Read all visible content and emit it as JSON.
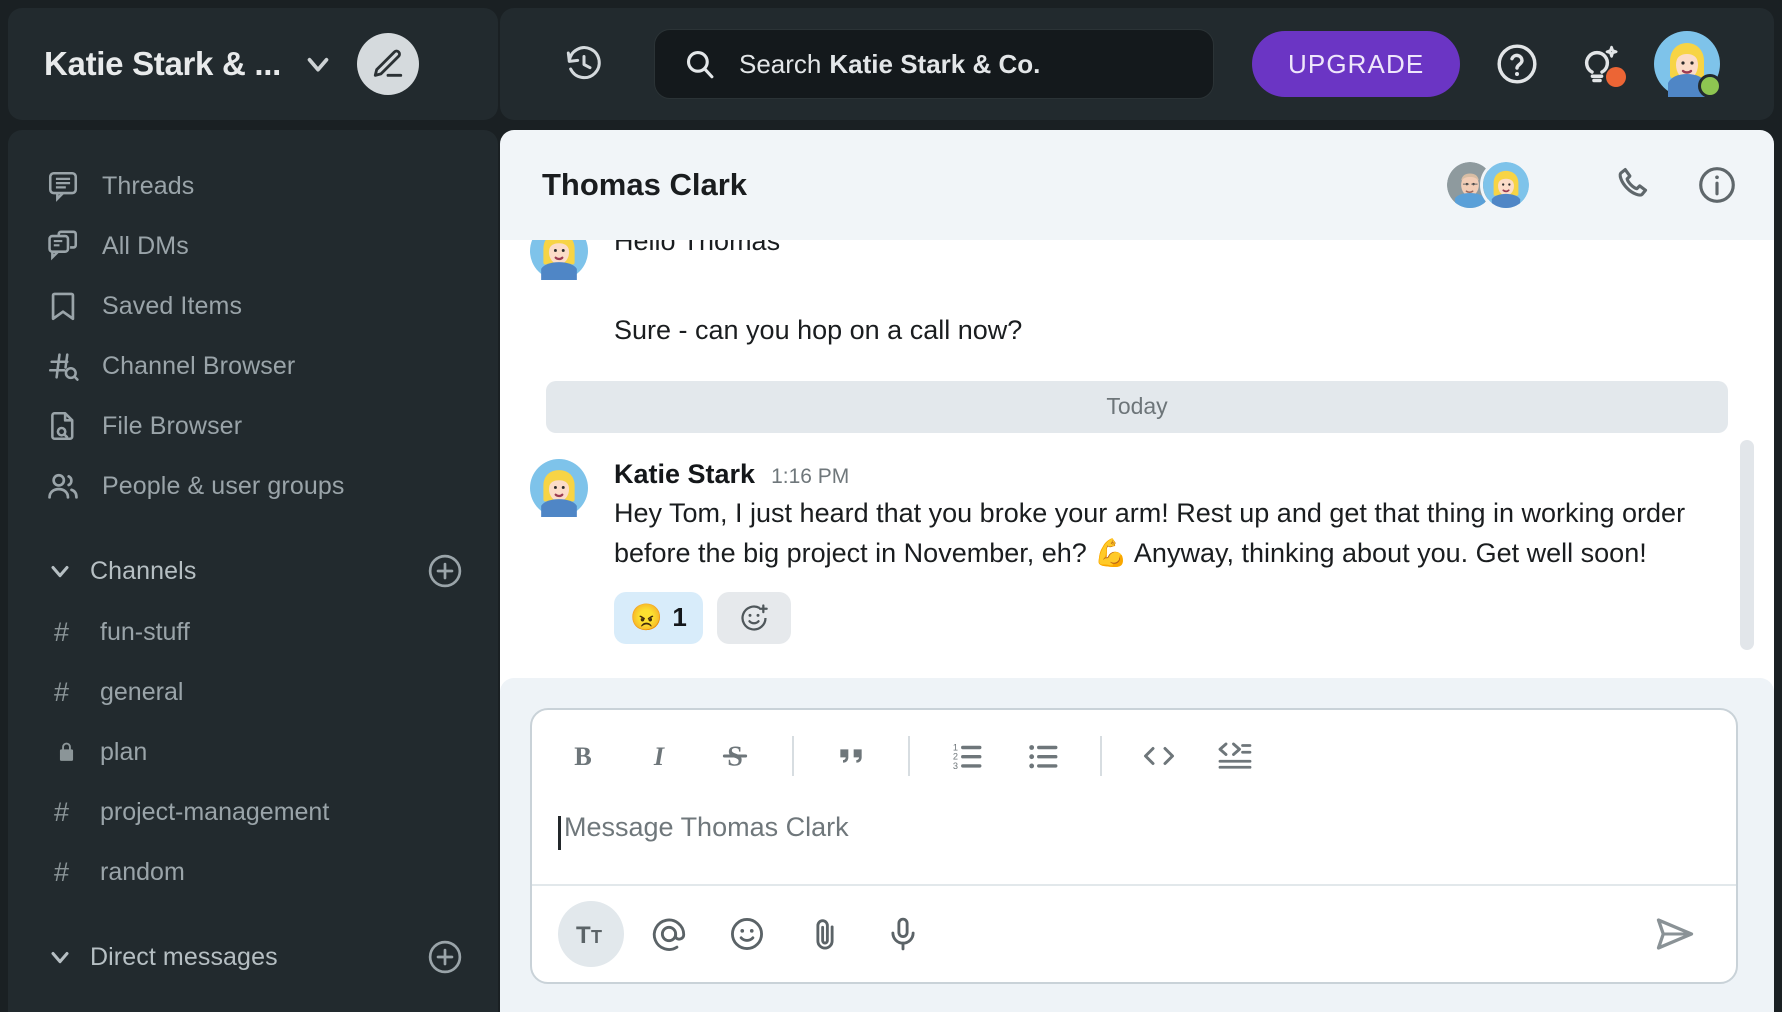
{
  "workspace": {
    "name": "Katie Stark & ...",
    "chevron_icon": "chevron-down-icon",
    "compose_icon": "pencil-icon"
  },
  "sidebar": {
    "nav_items": [
      {
        "label": "Threads",
        "icon": "threads-icon"
      },
      {
        "label": "All DMs",
        "icon": "all-dms-icon"
      },
      {
        "label": "Saved Items",
        "icon": "bookmark-icon"
      },
      {
        "label": "Channel Browser",
        "icon": "channel-browser-icon"
      },
      {
        "label": "File Browser",
        "icon": "file-browser-icon"
      },
      {
        "label": "People & user groups",
        "icon": "people-icon"
      }
    ],
    "channels_section": {
      "title": "Channels",
      "add_label": "+",
      "items": [
        {
          "name": "fun-stuff",
          "symbol": "#",
          "icon": "hash-icon"
        },
        {
          "name": "general",
          "symbol": "#",
          "icon": "hash-icon"
        },
        {
          "name": "plan",
          "symbol": "",
          "icon": "lock-icon"
        },
        {
          "name": "project-management",
          "symbol": "#",
          "icon": "hash-icon"
        },
        {
          "name": "random",
          "symbol": "#",
          "icon": "hash-icon"
        }
      ]
    },
    "dm_section": {
      "title": "Direct messages",
      "add_label": "+"
    }
  },
  "topbar": {
    "history_icon": "history-icon",
    "search": {
      "icon": "search-icon",
      "label": "Search",
      "scope": "Katie Stark & Co."
    },
    "upgrade_label": "UPGRADE",
    "help_icon": "help-circle-icon",
    "ai_icon": "lightbulb-sparkle-icon",
    "ai_badge_color": "#ec6535",
    "avatar_icon": "user-avatar",
    "presence_color": "#8ec551",
    "upgrade_color": "#6b35c4"
  },
  "conversation": {
    "title": "Thomas Clark",
    "members": [
      "thomas-avatar",
      "katie-avatar"
    ],
    "call_icon": "phone-icon",
    "info_icon": "info-circle-icon",
    "messages": [
      {
        "type": "continuation",
        "author": "",
        "time": "",
        "text": "Hello Thomas"
      },
      {
        "type": "continuation",
        "author": "",
        "time": "",
        "text": "Sure - can you hop on a call now?"
      }
    ],
    "divider": "Today",
    "featured_message": {
      "author": "Katie Stark",
      "time": "1:16 PM",
      "text": "Hey Tom, I just heard that you broke your arm! Rest up and get that thing in working order before the big project in November, eh? 💪 Anyway, thinking about you. Get well soon!",
      "reactions": [
        {
          "emoji": "😠",
          "count": "1",
          "color": "#d8ecfa"
        }
      ],
      "add_reaction_icon": "add-reaction-icon"
    }
  },
  "composer": {
    "placeholder": "Message Thomas Clark",
    "format_buttons": [
      {
        "icon": "bold-icon",
        "label": "B"
      },
      {
        "icon": "italic-icon",
        "label": "I"
      },
      {
        "icon": "strikethrough-icon",
        "label": "S"
      },
      {
        "icon": "blockquote-icon",
        "label": "””"
      },
      {
        "icon": "ordered-list-icon",
        "label": ""
      },
      {
        "icon": "bullet-list-icon",
        "label": ""
      },
      {
        "icon": "code-icon",
        "label": "<>"
      },
      {
        "icon": "code-block-icon",
        "label": ""
      }
    ],
    "action_buttons": [
      {
        "icon": "text-format-icon",
        "label": "Tt",
        "active": true
      },
      {
        "icon": "mention-icon",
        "label": "@",
        "active": false
      },
      {
        "icon": "emoji-icon",
        "label": "",
        "active": false
      },
      {
        "icon": "attachment-icon",
        "label": "",
        "active": false
      },
      {
        "icon": "microphone-icon",
        "label": "",
        "active": false
      }
    ],
    "send_icon": "send-icon"
  }
}
